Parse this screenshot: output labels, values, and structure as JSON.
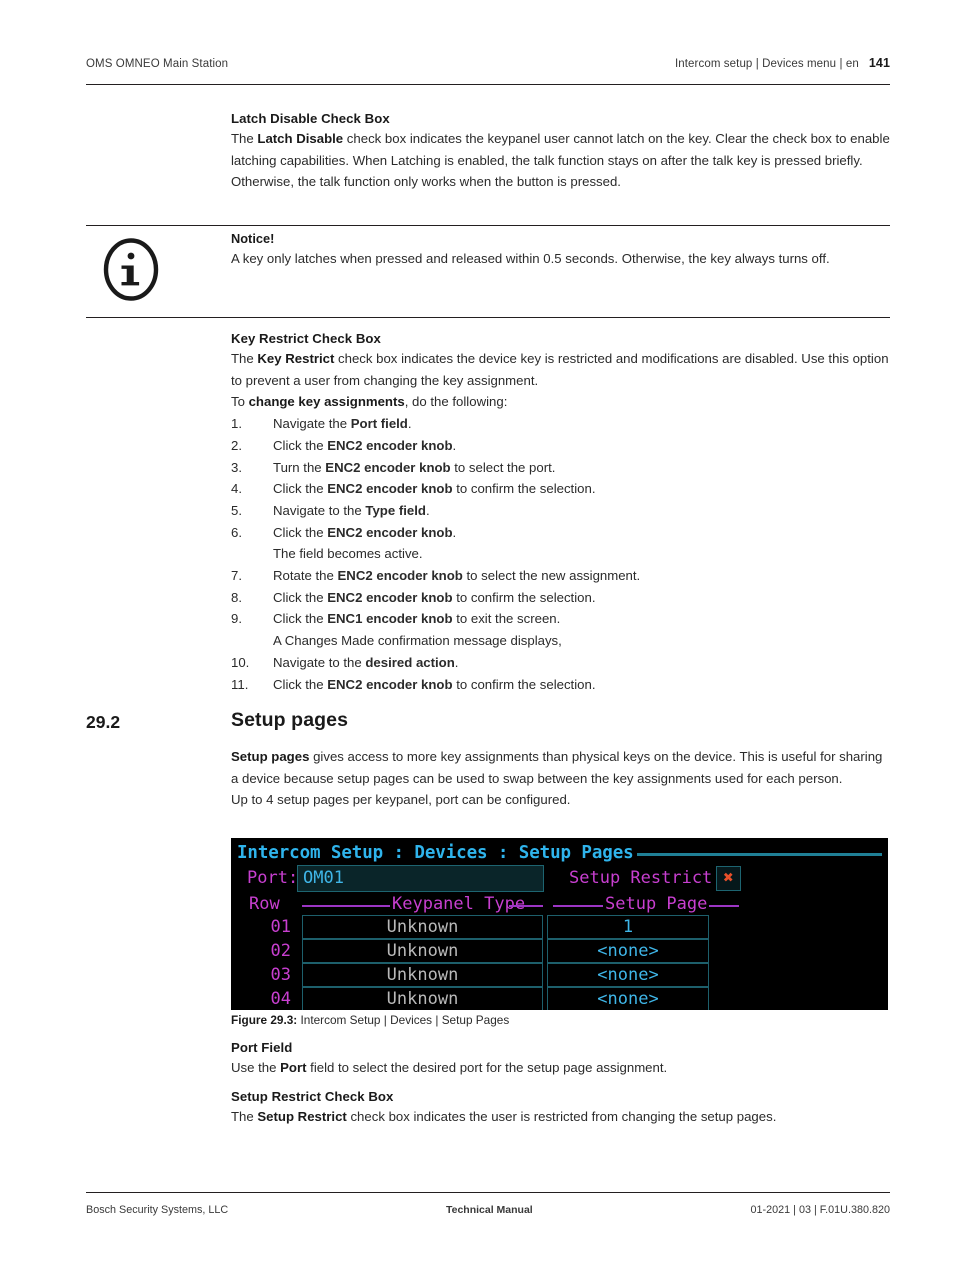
{
  "header": {
    "left": "OMS OMNEO Main Station",
    "breadcrumb": "Intercom setup | Devices menu | en",
    "page_number": "141"
  },
  "latch_section": {
    "heading": "Latch Disable Check Box",
    "body_1": "The ",
    "body_bold": "Latch Disable",
    "body_2": " check box indicates the keypanel user cannot latch on the key. Clear the check box to enable latching capabilities. When Latching is enabled, the talk function stays on after the talk key is pressed briefly. Otherwise, the talk function only works when the button is pressed."
  },
  "notice": {
    "icon": "info-icon",
    "title": "Notice!",
    "text": "A key only latches when pressed and released within 0.5 seconds. Otherwise, the key always turns off."
  },
  "key_restrict_section": {
    "heading": "Key Restrict Check Box",
    "body_1": "The ",
    "body_bold": "Key Restrict",
    "body_2": " check box indicates the device key is restricted and modifications are disabled. Use this option to prevent a user from changing the key assignment.",
    "intro_1": "To ",
    "intro_bold": "change key assignments",
    "intro_2": ", do the following:",
    "steps": [
      {
        "num": "1.",
        "pre": "Navigate the ",
        "bold": "Port field",
        "post": "."
      },
      {
        "num": "2.",
        "pre": "Click the ",
        "bold": "ENC2 encoder knob",
        "post": "."
      },
      {
        "num": "3.",
        "pre": "Turn the ",
        "bold": "ENC2 encoder knob",
        "post": " to select the port."
      },
      {
        "num": "4.",
        "pre": "Click the ",
        "bold": "ENC2 encoder knob",
        "post": " to confirm the selection."
      },
      {
        "num": "5.",
        "pre": "Navigate to the ",
        "bold": "Type field",
        "post": "."
      },
      {
        "num": "6.",
        "pre": "Click the ",
        "bold": "ENC2 encoder knob",
        "post": "."
      },
      {
        "num": "",
        "pre": "The field becomes active.",
        "bold": "",
        "post": ""
      },
      {
        "num": "7.",
        "pre": "Rotate the ",
        "bold": "ENC2 encoder knob",
        "post": " to select the new assignment."
      },
      {
        "num": "8.",
        "pre": "Click the ",
        "bold": "ENC2 encoder knob",
        "post": " to confirm the selection."
      },
      {
        "num": "9.",
        "pre": "Click the ",
        "bold": "ENC1 encoder knob",
        "post": " to exit the screen."
      },
      {
        "num": "",
        "pre": "A Changes Made confirmation message displays,",
        "bold": "",
        "post": ""
      },
      {
        "num": "10.",
        "pre": "Navigate to the ",
        "bold": "desired action",
        "post": "."
      },
      {
        "num": "11.",
        "pre": "Click the ",
        "bold": "ENC2 encoder knob",
        "post": " to confirm the selection."
      }
    ]
  },
  "setup_pages_section": {
    "number": "29.2",
    "title": "Setup pages",
    "body_bold": "Setup pages",
    "body_1": " gives access to more key assignments than physical keys on the device. This is useful for sharing a device because setup pages can be used to swap between the key assignments used for each person.",
    "body_2": "Up to 4 setup pages per keypanel, port can be configured."
  },
  "device_screen": {
    "title": "Intercom Setup : Devices : Setup Pages",
    "port_label": "Port:",
    "port_value": "OM01",
    "setup_restrict_label": "Setup Restrict:",
    "setup_restrict_value": "✖",
    "col_row": "Row",
    "col_keypanel_type": "Keypanel Type",
    "col_setup_page": "Setup Page",
    "rows": [
      {
        "row": "01",
        "type": "Unknown",
        "page": "1"
      },
      {
        "row": "02",
        "type": "Unknown",
        "page": "<none>"
      },
      {
        "row": "03",
        "type": "Unknown",
        "page": "<none>"
      },
      {
        "row": "04",
        "type": "Unknown",
        "page": "<none>"
      }
    ],
    "colors": {
      "title": "#2fb4ec",
      "label": "#c83fd0",
      "value": "#3fb6e8",
      "type_text": "#b9b9b9",
      "restrict_x": "#e8502a",
      "border": "#1d5f6b",
      "background": "#000000"
    }
  },
  "figure_caption": {
    "label": "Figure 29.3:",
    "text": " Intercom Setup | Devices | Setup Pages"
  },
  "port_field_section": {
    "heading": "Port Field",
    "body_1": "Use the ",
    "body_bold": "Port",
    "body_2": " field to select the desired port for the setup page assignment."
  },
  "setup_restrict_section": {
    "heading": "Setup Restrict Check Box",
    "body_1": "The ",
    "body_bold": "Setup Restrict",
    "body_2": " check box indicates the user is restricted from changing the setup pages."
  },
  "footer": {
    "left": "Bosch Security Systems, LLC",
    "center": "Technical Manual",
    "right": "01-2021 | 03 | F.01U.380.820"
  }
}
